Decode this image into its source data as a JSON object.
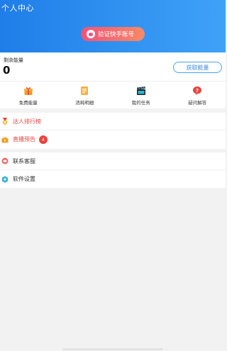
{
  "header": {
    "title": "个人中心",
    "verify_button": "验证快手账号",
    "verify_icon": "ghost-icon"
  },
  "energy": {
    "label": "剩余能量",
    "value": "0",
    "get_button": "获取能量"
  },
  "quick_actions": [
    {
      "label": "免费能量",
      "icon": "gift-icon"
    },
    {
      "label": "消耗明细",
      "icon": "receipt-icon"
    },
    {
      "label": "我的任务",
      "icon": "clapperboard-icon"
    },
    {
      "label": "疑问解答",
      "icon": "question-bubble-icon"
    }
  ],
  "menu_primary": [
    {
      "label": "达人排行榜",
      "icon": "medal-icon"
    },
    {
      "label": "直播预告",
      "icon": "tv-icon",
      "badge": "4"
    }
  ],
  "menu_secondary": [
    {
      "label": "联系客服",
      "icon": "chat-icon"
    },
    {
      "label": "软件设置",
      "icon": "settings-icon"
    }
  ],
  "colors": {
    "header_gradient_start": "#1f7ee8",
    "header_gradient_end": "#3fa2f7",
    "highlight_red": "#e8453c",
    "accent_blue": "#3a8de6"
  }
}
